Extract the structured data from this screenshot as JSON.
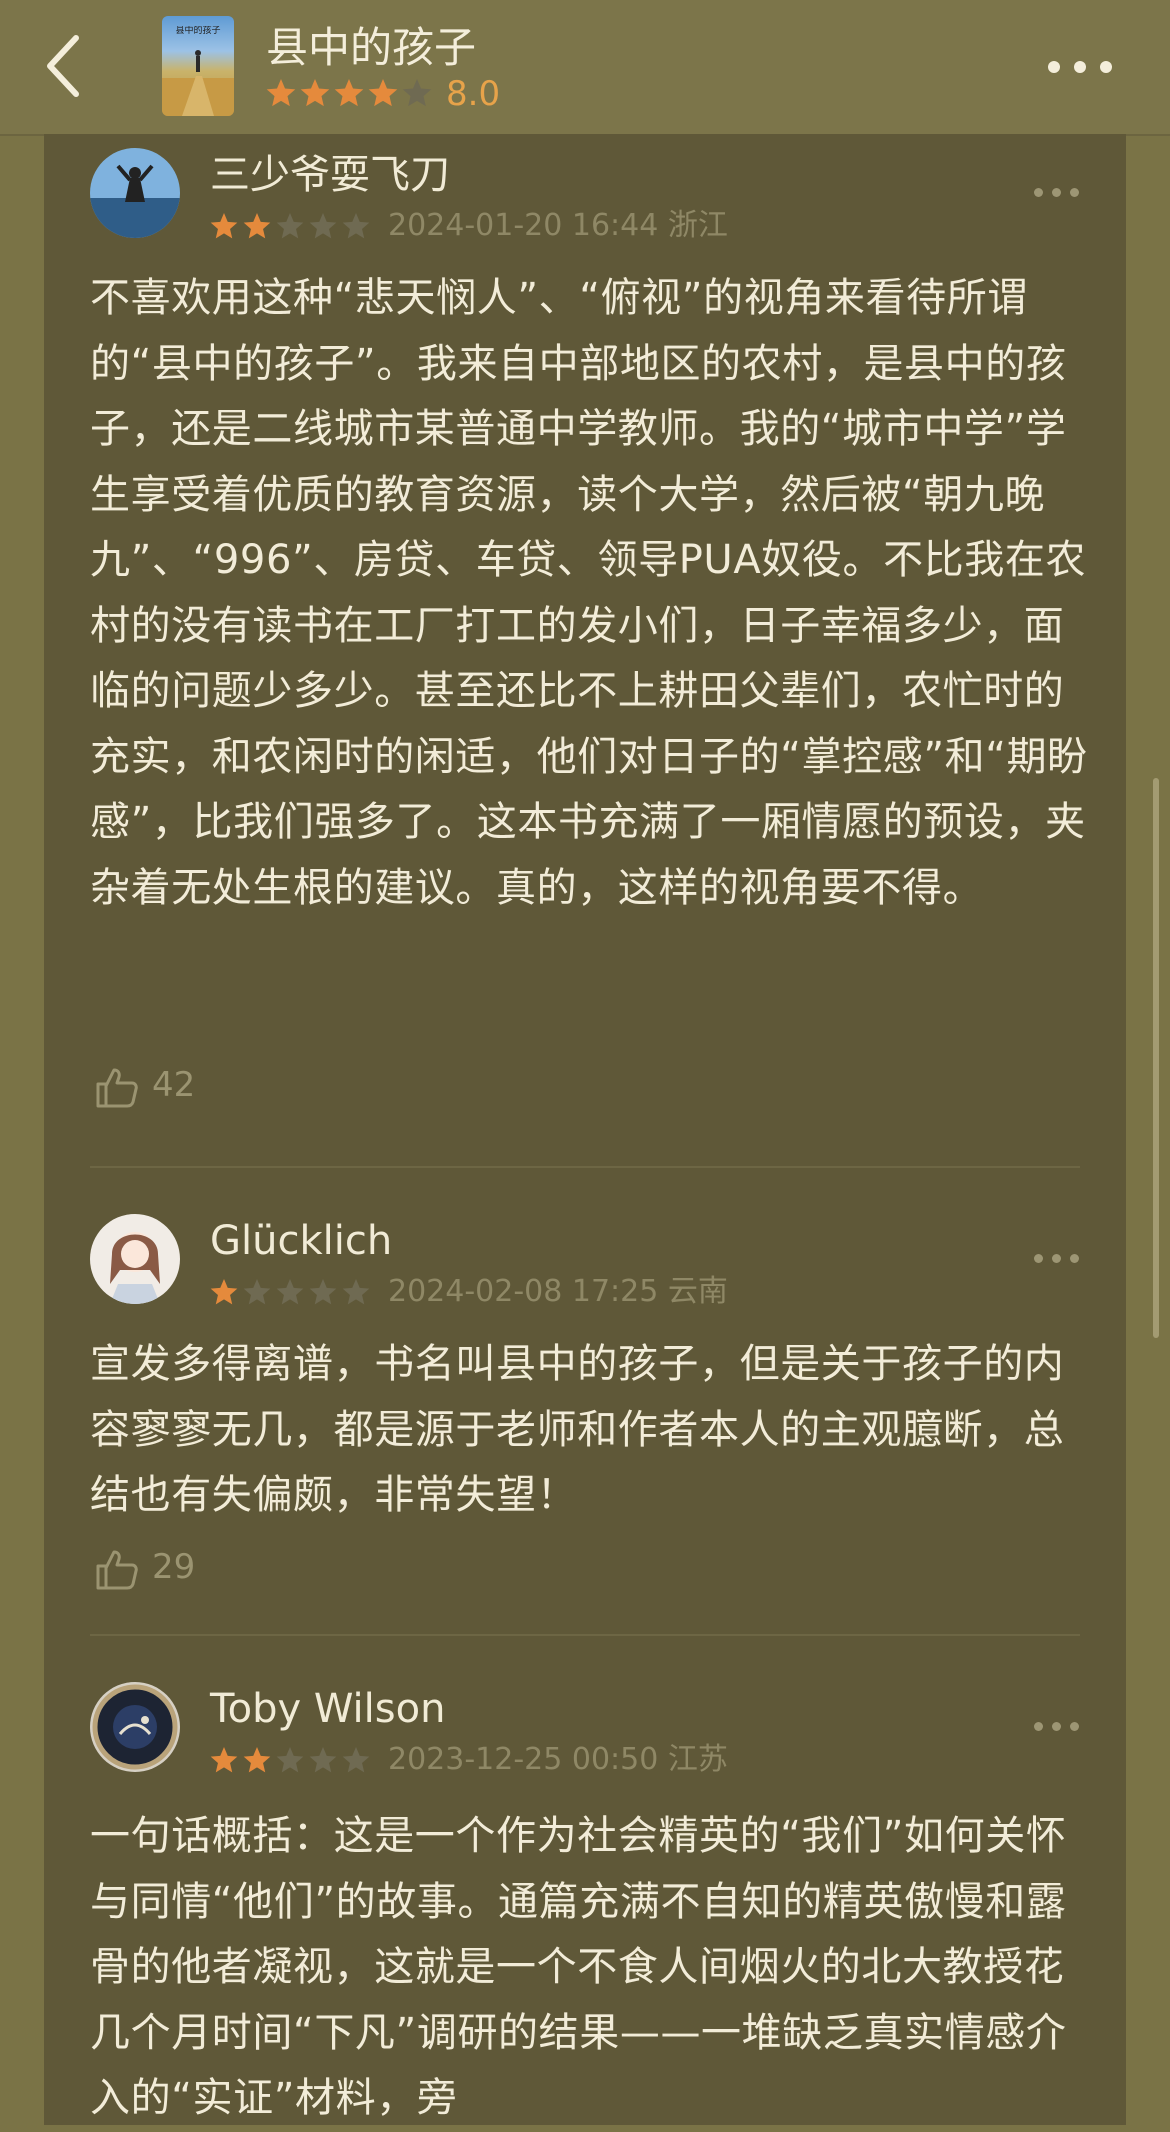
{
  "header": {
    "back_icon": "chevron-left-icon",
    "cover_title": "县中的孩子",
    "title": "县中的孩子",
    "rating_stars": 4,
    "score": "8.0",
    "more_icon": "more-horizontal-icon"
  },
  "colors": {
    "star_filled": "#e58a3c",
    "star_empty": "#6f6a52",
    "background": "#7a7346",
    "panel": "#5f5838"
  },
  "reviews": [
    {
      "username": "三少爷耍飞刀",
      "stars": 2,
      "meta": "2024-01-20 16:44 浙江",
      "text": "不喜欢用这种“悲天悯人”、“俯视”的视角来看待所谓的“县中的孩子”。我来自中部地区的农村，是县中的孩子，还是二线城市某普通中学教师。我的“城市中学”学生享受着优质的教育资源，读个大学，然后被“朝九晚九”、“996”、房贷、车贷、领导PUA奴役。不比我在农村的没有读书在工厂打工的发小们，日子幸福多少，面临的问题少多少。甚至还比不上耕田父辈们，农忙时的充实，和农闲时的闲适，他们对日子的“掌控感”和“期盼感”，比我们强多了。这本书充满了一厢情愿的预设，夹杂着无处生根的建议。真的，这样的视角要不得。",
      "likes": "42"
    },
    {
      "username": "Glücklich",
      "stars": 1,
      "meta": "2024-02-08 17:25 云南",
      "text": "宣发多得离谱，书名叫县中的孩子，但是关于孩子的内容寥寥无几，都是源于老师和作者本人的主观臆断，总结也有失偏颇，非常失望！",
      "likes": "29"
    },
    {
      "username": "Toby Wilson",
      "stars": 2,
      "meta": "2023-12-25 00:50 江苏",
      "text": "一句话概括：这是一个作为社会精英的“我们”如何关怀与同情“他们”的故事。通篇充满不自知的精英傲慢和露骨的他者凝视，这就是一个不食人间烟火的北大教授花几个月时间“下凡”调研的结果——一堆缺乏真实情感介入的“实证”材料，旁",
      "likes": ""
    }
  ]
}
